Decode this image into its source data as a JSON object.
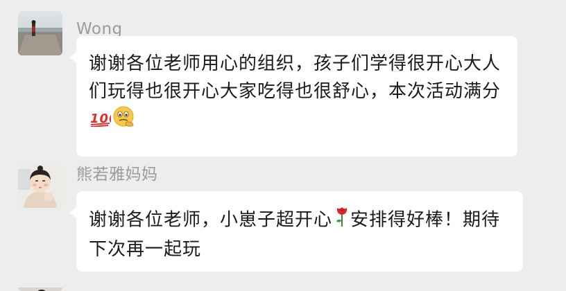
{
  "messages": [
    {
      "sender": "Wong",
      "text": "谢谢各位老师用心的组织，孩子们学得很开心大人们玩得也很开心大家吃得也很舒心，本次活动满分",
      "emojis": [
        "hundred-points-emoji",
        "thinking-face-emoji"
      ]
    },
    {
      "sender": "熊若雅妈妈",
      "text_before": "谢谢各位老师，小崽子超开心",
      "text_after": "安排得好棒！期待下次再一起玩",
      "emojis": [
        "rose-emoji"
      ]
    }
  ]
}
